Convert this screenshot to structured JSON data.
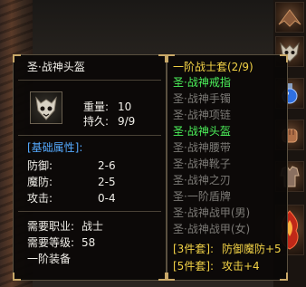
{
  "item": {
    "name": "圣·战神头盔",
    "icon": "helmet-skull-icon",
    "weight_label": "重量:",
    "weight_value": "10",
    "durability_label": "持久:",
    "durability_value": "9/9",
    "base_attr_title": "[基础属性]:",
    "attributes": [
      {
        "label": "防御:",
        "value": "2-6"
      },
      {
        "label": "魔防:",
        "value": "2-5"
      },
      {
        "label": "攻击:",
        "value": "0-4"
      }
    ],
    "req_job_label": "需要职业:",
    "req_job_value": "战士",
    "req_level_label": "需要等级:",
    "req_level_value": "58",
    "tier": "一阶装备"
  },
  "set": {
    "title": "一阶战士套(2/9)",
    "pieces": [
      {
        "name": "圣·战神戒指",
        "owned": true
      },
      {
        "name": "圣·战神手镯",
        "owned": false
      },
      {
        "name": "圣·战神项链",
        "owned": false
      },
      {
        "name": "圣·战神头盔",
        "owned": true
      },
      {
        "name": "圣·战神腰带",
        "owned": false
      },
      {
        "name": "圣·战神靴子",
        "owned": false
      },
      {
        "name": "圣·战神之刃",
        "owned": false
      },
      {
        "name": "圣·一阶盾牌",
        "owned": false
      },
      {
        "name": "圣·战神战甲(男)",
        "owned": false
      },
      {
        "name": "圣·战神战甲(女)",
        "owned": false
      }
    ],
    "bonuses": [
      {
        "label": "[3件套]:",
        "value": "防御魔防+5"
      },
      {
        "label": "[5件套]:",
        "value": "攻击+4"
      }
    ]
  },
  "colors": {
    "title_gold": "#f2d246",
    "owned_green": "#4cf05a",
    "missing_gray": "#7c7a76",
    "attr_blue": "#55aaff"
  },
  "side_icons": [
    "wing-icon",
    "demon-mask-icon",
    "potion-icon",
    "fist-icon",
    "armor-icon",
    "fire-armor-icon"
  ]
}
